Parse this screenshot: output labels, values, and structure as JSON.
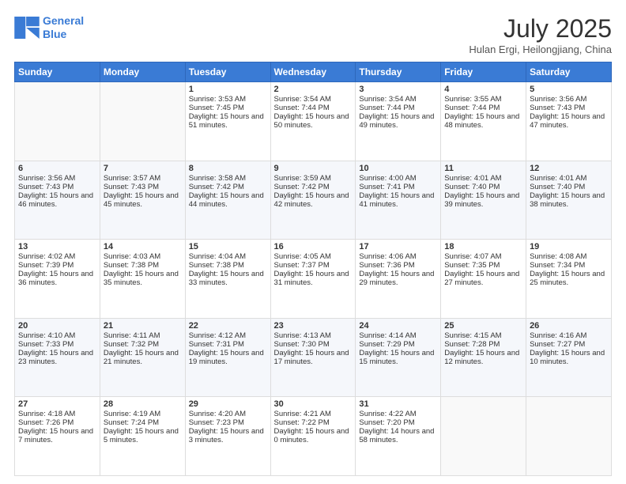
{
  "header": {
    "logo_line1": "General",
    "logo_line2": "Blue",
    "month": "July 2025",
    "location": "Hulan Ergi, Heilongjiang, China"
  },
  "weekdays": [
    "Sunday",
    "Monday",
    "Tuesday",
    "Wednesday",
    "Thursday",
    "Friday",
    "Saturday"
  ],
  "weeks": [
    [
      {
        "day": "",
        "sunrise": "",
        "sunset": "",
        "daylight": ""
      },
      {
        "day": "",
        "sunrise": "",
        "sunset": "",
        "daylight": ""
      },
      {
        "day": "1",
        "sunrise": "Sunrise: 3:53 AM",
        "sunset": "Sunset: 7:45 PM",
        "daylight": "Daylight: 15 hours and 51 minutes."
      },
      {
        "day": "2",
        "sunrise": "Sunrise: 3:54 AM",
        "sunset": "Sunset: 7:44 PM",
        "daylight": "Daylight: 15 hours and 50 minutes."
      },
      {
        "day": "3",
        "sunrise": "Sunrise: 3:54 AM",
        "sunset": "Sunset: 7:44 PM",
        "daylight": "Daylight: 15 hours and 49 minutes."
      },
      {
        "day": "4",
        "sunrise": "Sunrise: 3:55 AM",
        "sunset": "Sunset: 7:44 PM",
        "daylight": "Daylight: 15 hours and 48 minutes."
      },
      {
        "day": "5",
        "sunrise": "Sunrise: 3:56 AM",
        "sunset": "Sunset: 7:43 PM",
        "daylight": "Daylight: 15 hours and 47 minutes."
      }
    ],
    [
      {
        "day": "6",
        "sunrise": "Sunrise: 3:56 AM",
        "sunset": "Sunset: 7:43 PM",
        "daylight": "Daylight: 15 hours and 46 minutes."
      },
      {
        "day": "7",
        "sunrise": "Sunrise: 3:57 AM",
        "sunset": "Sunset: 7:43 PM",
        "daylight": "Daylight: 15 hours and 45 minutes."
      },
      {
        "day": "8",
        "sunrise": "Sunrise: 3:58 AM",
        "sunset": "Sunset: 7:42 PM",
        "daylight": "Daylight: 15 hours and 44 minutes."
      },
      {
        "day": "9",
        "sunrise": "Sunrise: 3:59 AM",
        "sunset": "Sunset: 7:42 PM",
        "daylight": "Daylight: 15 hours and 42 minutes."
      },
      {
        "day": "10",
        "sunrise": "Sunrise: 4:00 AM",
        "sunset": "Sunset: 7:41 PM",
        "daylight": "Daylight: 15 hours and 41 minutes."
      },
      {
        "day": "11",
        "sunrise": "Sunrise: 4:01 AM",
        "sunset": "Sunset: 7:40 PM",
        "daylight": "Daylight: 15 hours and 39 minutes."
      },
      {
        "day": "12",
        "sunrise": "Sunrise: 4:01 AM",
        "sunset": "Sunset: 7:40 PM",
        "daylight": "Daylight: 15 hours and 38 minutes."
      }
    ],
    [
      {
        "day": "13",
        "sunrise": "Sunrise: 4:02 AM",
        "sunset": "Sunset: 7:39 PM",
        "daylight": "Daylight: 15 hours and 36 minutes."
      },
      {
        "day": "14",
        "sunrise": "Sunrise: 4:03 AM",
        "sunset": "Sunset: 7:38 PM",
        "daylight": "Daylight: 15 hours and 35 minutes."
      },
      {
        "day": "15",
        "sunrise": "Sunrise: 4:04 AM",
        "sunset": "Sunset: 7:38 PM",
        "daylight": "Daylight: 15 hours and 33 minutes."
      },
      {
        "day": "16",
        "sunrise": "Sunrise: 4:05 AM",
        "sunset": "Sunset: 7:37 PM",
        "daylight": "Daylight: 15 hours and 31 minutes."
      },
      {
        "day": "17",
        "sunrise": "Sunrise: 4:06 AM",
        "sunset": "Sunset: 7:36 PM",
        "daylight": "Daylight: 15 hours and 29 minutes."
      },
      {
        "day": "18",
        "sunrise": "Sunrise: 4:07 AM",
        "sunset": "Sunset: 7:35 PM",
        "daylight": "Daylight: 15 hours and 27 minutes."
      },
      {
        "day": "19",
        "sunrise": "Sunrise: 4:08 AM",
        "sunset": "Sunset: 7:34 PM",
        "daylight": "Daylight: 15 hours and 25 minutes."
      }
    ],
    [
      {
        "day": "20",
        "sunrise": "Sunrise: 4:10 AM",
        "sunset": "Sunset: 7:33 PM",
        "daylight": "Daylight: 15 hours and 23 minutes."
      },
      {
        "day": "21",
        "sunrise": "Sunrise: 4:11 AM",
        "sunset": "Sunset: 7:32 PM",
        "daylight": "Daylight: 15 hours and 21 minutes."
      },
      {
        "day": "22",
        "sunrise": "Sunrise: 4:12 AM",
        "sunset": "Sunset: 7:31 PM",
        "daylight": "Daylight: 15 hours and 19 minutes."
      },
      {
        "day": "23",
        "sunrise": "Sunrise: 4:13 AM",
        "sunset": "Sunset: 7:30 PM",
        "daylight": "Daylight: 15 hours and 17 minutes."
      },
      {
        "day": "24",
        "sunrise": "Sunrise: 4:14 AM",
        "sunset": "Sunset: 7:29 PM",
        "daylight": "Daylight: 15 hours and 15 minutes."
      },
      {
        "day": "25",
        "sunrise": "Sunrise: 4:15 AM",
        "sunset": "Sunset: 7:28 PM",
        "daylight": "Daylight: 15 hours and 12 minutes."
      },
      {
        "day": "26",
        "sunrise": "Sunrise: 4:16 AM",
        "sunset": "Sunset: 7:27 PM",
        "daylight": "Daylight: 15 hours and 10 minutes."
      }
    ],
    [
      {
        "day": "27",
        "sunrise": "Sunrise: 4:18 AM",
        "sunset": "Sunset: 7:26 PM",
        "daylight": "Daylight: 15 hours and 7 minutes."
      },
      {
        "day": "28",
        "sunrise": "Sunrise: 4:19 AM",
        "sunset": "Sunset: 7:24 PM",
        "daylight": "Daylight: 15 hours and 5 minutes."
      },
      {
        "day": "29",
        "sunrise": "Sunrise: 4:20 AM",
        "sunset": "Sunset: 7:23 PM",
        "daylight": "Daylight: 15 hours and 3 minutes."
      },
      {
        "day": "30",
        "sunrise": "Sunrise: 4:21 AM",
        "sunset": "Sunset: 7:22 PM",
        "daylight": "Daylight: 15 hours and 0 minutes."
      },
      {
        "day": "31",
        "sunrise": "Sunrise: 4:22 AM",
        "sunset": "Sunset: 7:20 PM",
        "daylight": "Daylight: 14 hours and 58 minutes."
      },
      {
        "day": "",
        "sunrise": "",
        "sunset": "",
        "daylight": ""
      },
      {
        "day": "",
        "sunrise": "",
        "sunset": "",
        "daylight": ""
      }
    ]
  ]
}
